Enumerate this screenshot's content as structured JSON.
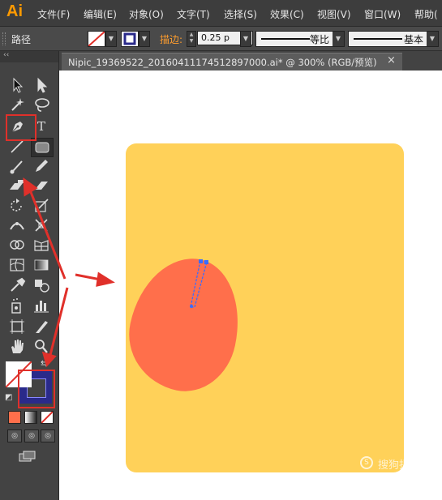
{
  "app": {
    "logo": "Ai"
  },
  "menu": [
    "文件(F)",
    "编辑(E)",
    "对象(O)",
    "文字(T)",
    "选择(S)",
    "效果(C)",
    "视图(V)",
    "窗口(W)",
    "帮助("
  ],
  "control_bar": {
    "object_label": "路径",
    "stroke_label": "描边:",
    "stroke_weight": "0.25 p",
    "profile_1": "等比",
    "profile_2": "基本"
  },
  "document": {
    "tab_title": "Nipic_19369522_20160411174512897000.ai*  @  300%  (RGB/预览)",
    "close_glyph": "×"
  },
  "tools": {
    "collapse": "‹‹",
    "type_tool": "T"
  },
  "watermark": {
    "text": "搜狗指南",
    "icon": "S"
  },
  "colors": {
    "accent_orange": "#ff9a00",
    "artboard_fill": "#ffd159",
    "egg_fill": "#ff6f4b",
    "annotation_red": "#e0302a",
    "path_blue": "#3b6cff"
  }
}
